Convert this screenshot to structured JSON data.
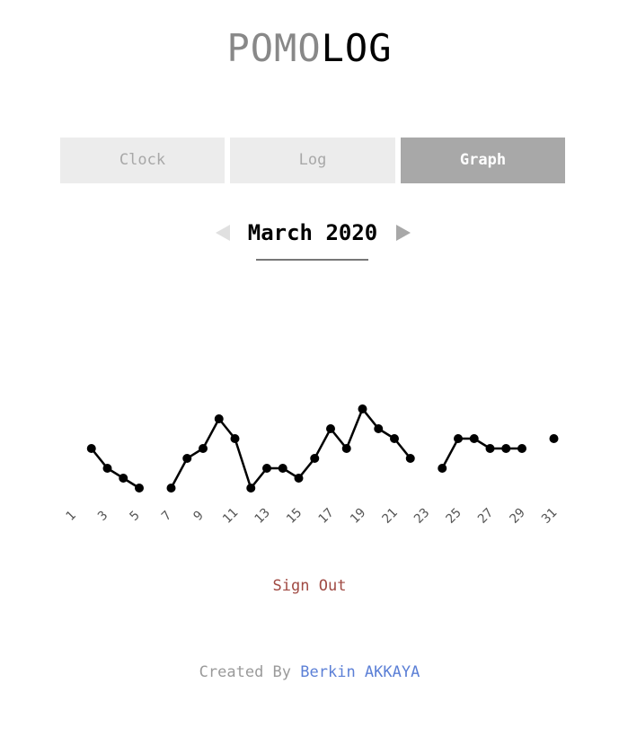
{
  "app": {
    "logo_light": "POMO",
    "logo_dark": "LOG"
  },
  "tabs": [
    {
      "label": "Clock",
      "active": false
    },
    {
      "label": "Log",
      "active": false
    },
    {
      "label": "Graph",
      "active": true
    }
  ],
  "month_nav": {
    "label": "March 2020",
    "prev_icon": "triangle-left-icon",
    "next_icon": "triangle-right-icon"
  },
  "chart_data": {
    "type": "line",
    "title": "",
    "xlabel": "",
    "ylabel": "",
    "x_tick_labels": [
      "1",
      "3",
      "5",
      "7",
      "9",
      "11",
      "13",
      "15",
      "17",
      "19",
      "21",
      "23",
      "25",
      "27",
      "29",
      "31"
    ],
    "x": [
      2,
      3,
      4,
      5,
      7,
      8,
      9,
      10,
      11,
      12,
      13,
      14,
      15,
      16,
      17,
      18,
      19,
      20,
      21,
      22,
      24,
      25,
      26,
      27,
      28,
      29,
      31
    ],
    "values": [
      5,
      3,
      2,
      1,
      1,
      4,
      5,
      8,
      6,
      1,
      3,
      3,
      2,
      4,
      7,
      5,
      9,
      7,
      6,
      4,
      3,
      6,
      6,
      5,
      5,
      5,
      6
    ],
    "segments": [
      [
        2,
        3,
        4,
        5
      ],
      [
        7,
        8,
        9,
        10,
        11,
        12,
        13,
        14,
        15,
        16,
        17,
        18,
        19,
        20,
        21,
        22
      ],
      [
        24,
        25,
        26,
        27,
        28,
        29
      ],
      [
        31
      ]
    ],
    "xlim": [
      1,
      31
    ],
    "grid": false,
    "color": "#000000"
  },
  "actions": {
    "sign_out": "Sign Out"
  },
  "footer": {
    "prefix": "Created By",
    "author": "Berkin AKKAYA"
  },
  "colors": {
    "active_tab": "#a8a8a8",
    "inactive_tab": "#ececec",
    "sign_out": "#a04a43",
    "author_link": "#5b7fd6"
  }
}
